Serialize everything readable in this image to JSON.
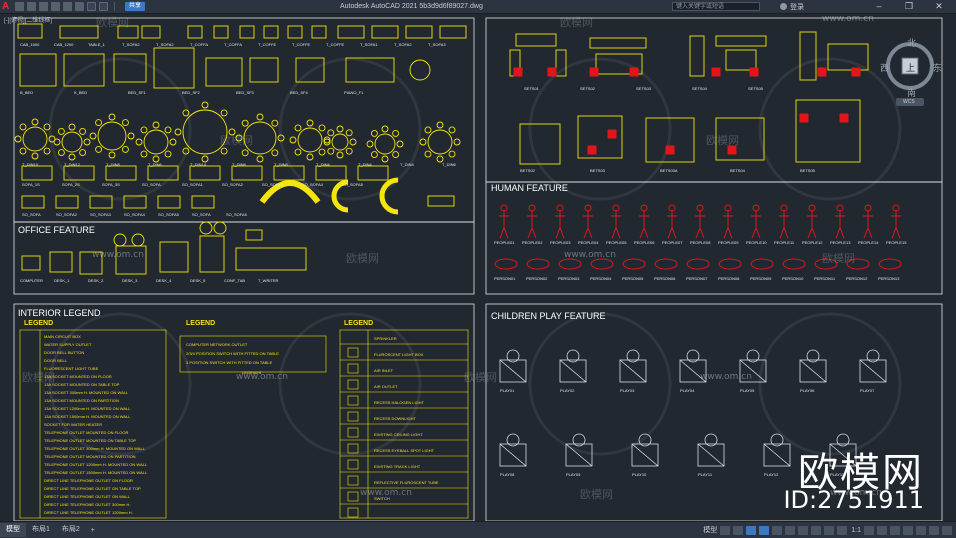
{
  "window": {
    "title": "Autodesk AutoCAD 2021    5b3d9d6f89027.dwg",
    "search_placeholder": "键入关键字或短语",
    "login_label": "登录",
    "share_label": "共享",
    "view_control": "[-][俯视][二维线框]"
  },
  "viewcube": {
    "north": "北",
    "south": "南",
    "east": "东",
    "west": "西",
    "top": "上",
    "wcs": "WCS"
  },
  "sections": {
    "office": "OFFICE FEATURE",
    "human": "HUMAN FEATURE",
    "interior": "INTERIOR LEGEND",
    "children": "CHILDREN PLAY FEATURE"
  },
  "legend": {
    "header": "LEGEND",
    "left_rows": [
      "MAIN CIRCUIT BOX",
      "WATER SUPPLY OUTLET",
      "DOOR BELL BUTTON",
      "DOOR BELL",
      "FLUORESCENT LIGHT TUBE",
      "13A SOCKET MOUNTED ON FLOOR",
      "13A SOCKET MOUNTED ON TABLE TOP",
      "13A SOCKET 300mm H. MOUNTED ON WALL",
      "13A SOCKET MOUNTED ON PARTITION",
      "13A SOCKET 1200mm H. MOUNTED ON WALL",
      "13A SOCKET 1500mm H. MOUNTED ON WALL",
      "SOCKET FOR WATER HEATER",
      "TELEPHONE OUTLET MOUNTED ON FLOOR",
      "TELEPHONE OUTLET MOUNTED ON TABLE TOP",
      "TELEPHONE OUTLET 300mm H. MOUNTED ON WALL",
      "TELEPHONE OUTLET MOUNTED ON PARTITION",
      "TELEPHONE OUTLET 1200mm H. MOUNTED ON WALL",
      "TELEPHONE OUTLET 1500mm H. MOUNTED ON WALL",
      "DIRECT LINE TELEPHONE OUTLET ON FLOOR",
      "DIRECT LINE TELEPHONE OUTLET ON TABLE TOP",
      "DIRECT LINE TELEPHONE OUTLET ON WALL",
      "DIRECT LINE TELEPHONE OUTLET 300mm H.",
      "DIRECT LINE TELEPHONE OUTLET 1200mm H."
    ],
    "mid_rows": [
      "COMPUTER NETWORK OUTLET",
      "2/3/4 POSITION SWITCH WITH FITTED ON TABLE",
      "3 POSITION SWITCH WITH FITTED ON TABLE"
    ],
    "mid_caption": "LEGENDS",
    "right_rows": [
      "SPRINKLER",
      "FLUROSCENT LIGHT BOX",
      "AIR INLET",
      "AIR OUTLET",
      "RECESS HALOGEN LIGHT",
      "RECESS DOWNLIGHT",
      "EXISTING CEILING LIGHT",
      "RECESS EYEBALL SPOT LIGHT",
      "EXISTING TRACK LIGHT",
      "REFLECTIVE FLUROSCENT TUBE",
      "SWITCH"
    ]
  },
  "labels": {
    "top_row": [
      "CAB_1500",
      "CAB_1200",
      "TABLE_1",
      "T_SOFA2",
      "T_SOFA2",
      "T_COFFA",
      "T_COFFA",
      "T_COFFE",
      "T_COFFE",
      "T_COFFE",
      "T_SOFA1",
      "T_SOFA2",
      "T_SOFA3"
    ],
    "row2": [
      "B_BED",
      "K_BED",
      "BED_SF1",
      "BED_SF2",
      "BED_SF3",
      "BED_SF4",
      "PIANO_F1"
    ],
    "row3": [
      "T_DIN10",
      "T_DIN12",
      "T_DIN8",
      "T_DIN6",
      "T_DIN14",
      "T_DIN8",
      "T_DIN8",
      "T_DIN4",
      "T_DIN4",
      "T_DIN4",
      "T_DIN6"
    ],
    "row4": [
      "SOFA_1S",
      "SOFA_2S",
      "SOFA_3S",
      "SO_SOFA",
      "SO_SOFA1",
      "SO_SOFA2",
      "SO_SOFA3",
      "SO_SOFA4",
      "SO_SOFA5"
    ],
    "row5": [
      "SO_SOFA",
      "SO_SOFA2",
      "SO_SOFA3",
      "SO_SOFA4",
      "SO_SOFA5",
      "SO_SOFA",
      "SO_SOFA5"
    ],
    "office": [
      "COMPUTER",
      "DESK_1",
      "DESK_2",
      "DESK_3",
      "DESK_4",
      "DESK_5",
      "CONF_TAB",
      "T_WRITER"
    ],
    "living_top": [
      "SETS01",
      "SETS02",
      "SETS03",
      "SETS04",
      "SETS05"
    ],
    "living_bottom": [
      "BETS02",
      "BETS03",
      "BETS03A",
      "BETS04",
      "BETS05"
    ],
    "human_top": [
      "PEOPLE01",
      "PEOPLE02",
      "PEOPLE03",
      "PEOPLE04",
      "PEOPLE05",
      "PEOPLE06",
      "PEOPLE07",
      "PEOPLE08",
      "PEOPLE09",
      "PEOPLE10",
      "PEOPLE11",
      "PEOPLE12",
      "PEOPLE13",
      "PEOPLE14",
      "PEOPLE15"
    ],
    "human_bottom": [
      "PERSON01",
      "PERSON02",
      "PERSON03",
      "PERSON04",
      "PERSON05",
      "PERSON06",
      "PERSON07",
      "PERSON08",
      "PERSON09",
      "PERSON10",
      "PERSON11",
      "PERSON12",
      "PERSON13"
    ],
    "play": [
      "PLAY01",
      "PLAY02",
      "PLAY03",
      "PLAY04",
      "PLAY05",
      "PLAY06",
      "PLAY07",
      "PLAY08",
      "PLAY09",
      "PLAY10",
      "PLAY11",
      "PLAY12",
      "PLAY13"
    ]
  },
  "watermarks": {
    "brand": "欧模网",
    "url": "www.om.cn",
    "id": "ID:2751911"
  },
  "statusbar": {
    "tabs": [
      "模型",
      "布局1",
      "布局2"
    ],
    "add_tab": "+",
    "model_label": "模型",
    "scale": "1:1"
  },
  "colors": {
    "background": "#212830",
    "cad_yellow": "#f4e50c",
    "cad_red": "#e3151a",
    "frame_white": "#e6e6e6"
  }
}
